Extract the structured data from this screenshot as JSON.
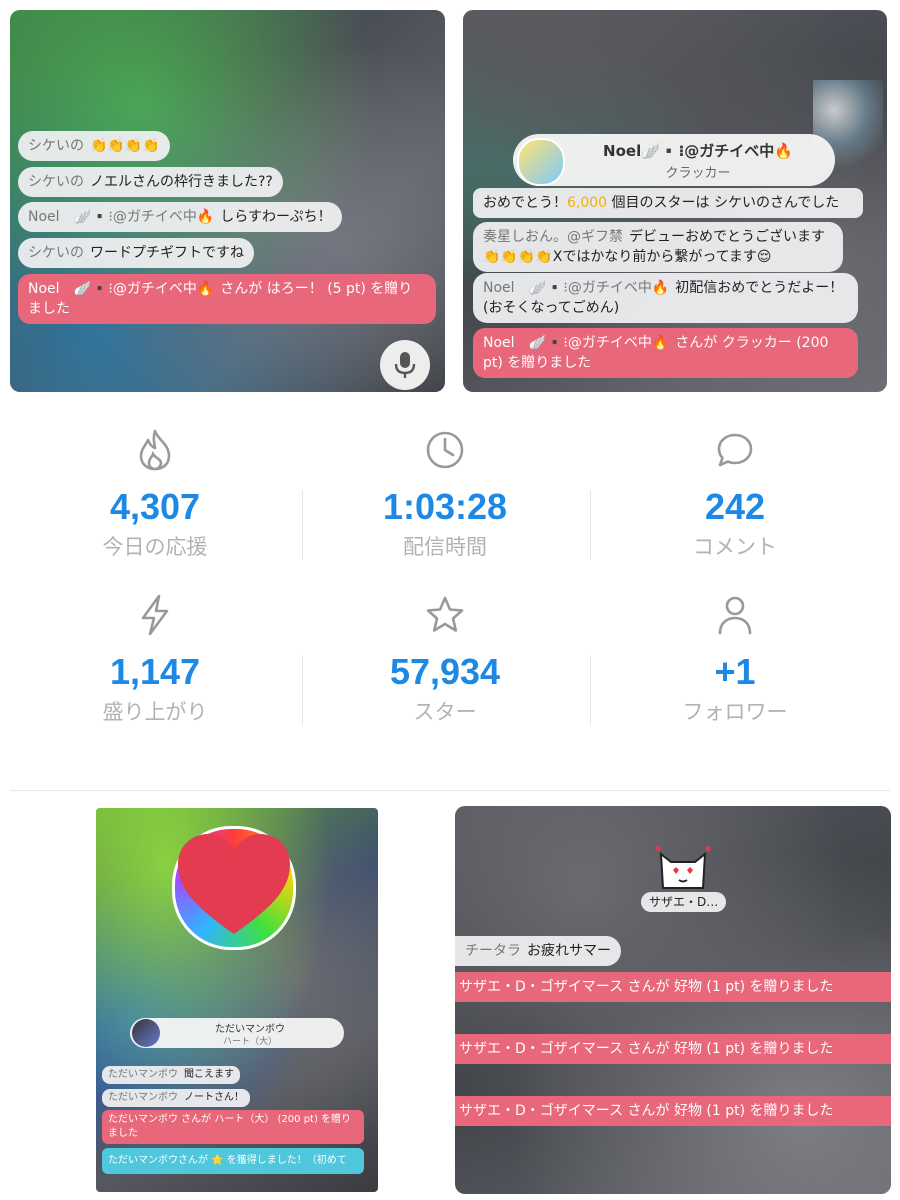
{
  "panel_top_left": {
    "comments": [
      {
        "name": "シケいの",
        "text": "👏👏👏👏"
      },
      {
        "name": "シケいの",
        "text": "ノエルさんの枠行きました??"
      },
      {
        "name": "Noel　🪽▪️⁝@ガチイベ中🔥",
        "text": "しらすわーぷち！"
      },
      {
        "name": "シケいの",
        "text": "ワードプチギフトですね"
      }
    ],
    "gift": {
      "name": "Noel　🪽▪️⁝@ガチイベ中🔥",
      "text": "さんが はろー！ (5 pt) を贈りました"
    },
    "mic_icon": "microphone-icon"
  },
  "panel_top_right": {
    "gift_card": {
      "title": "Noel🪽▪️⁝@ガチイベ中🔥",
      "subtitle": "クラッカー"
    },
    "star_notice": {
      "pre": "おめでとう！",
      "count": "6,000",
      "post": " 個目のスターは シケいのさんでした"
    },
    "comments": [
      {
        "name": "奏星しおん。@ギフ禁",
        "text": "デビューおめでとうございます👏👏👏👏Xではかなり前から繋がってます😌"
      },
      {
        "name": "Noel　🪽▪️⁝@ガチイベ中🔥",
        "text": "初配信おめでとうだよー！(おそくなってごめん)"
      }
    ],
    "gift": {
      "name": "Noel　🪽▪️⁝@ガチイベ中🔥",
      "text": "さんが クラッカー (200 pt) を贈りました"
    }
  },
  "stats": [
    {
      "icon": "flame-icon",
      "value": "4,307",
      "label": "今日の応援"
    },
    {
      "icon": "clock-icon",
      "value": "1:03:28",
      "label": "配信時間"
    },
    {
      "icon": "comment-icon",
      "value": "242",
      "label": "コメント"
    },
    {
      "icon": "lightning-icon",
      "value": "1,147",
      "label": "盛り上がり"
    },
    {
      "icon": "star-icon",
      "value": "57,934",
      "label": "スター"
    },
    {
      "icon": "person-icon",
      "value": "+1",
      "label": "フォロワー"
    }
  ],
  "panel_bottom_left": {
    "gift_card": {
      "title": "ただいマンボウ",
      "subtitle": "ハート（大）"
    },
    "comments": [
      {
        "name": "ただいマンボウ",
        "text": "聞こえます"
      },
      {
        "name": "ただいマンボウ",
        "text": "ノートさん！"
      }
    ],
    "gift": {
      "text": "ただいマンボウ さんが ハート（大） (200 pt) を贈りました"
    },
    "star": {
      "text": "ただいマンボウさんが ⭐ を獲得しました！（初めて"
    }
  },
  "panel_bottom_right": {
    "gift_card": {
      "title": "サザエ・D…"
    },
    "comments": [
      {
        "name": "チータラ",
        "text": "お疲れサマー"
      }
    ],
    "gifts": [
      {
        "text": "サザエ・D・ゴザイマース さんが 好物 (1 pt) を贈りました"
      },
      {
        "text": "サザエ・D・ゴザイマース さんが 好物 (1 pt) を贈りました"
      },
      {
        "text": "サザエ・D・ゴザイマース さんが 好物 (1 pt) を贈りました"
      }
    ]
  }
}
